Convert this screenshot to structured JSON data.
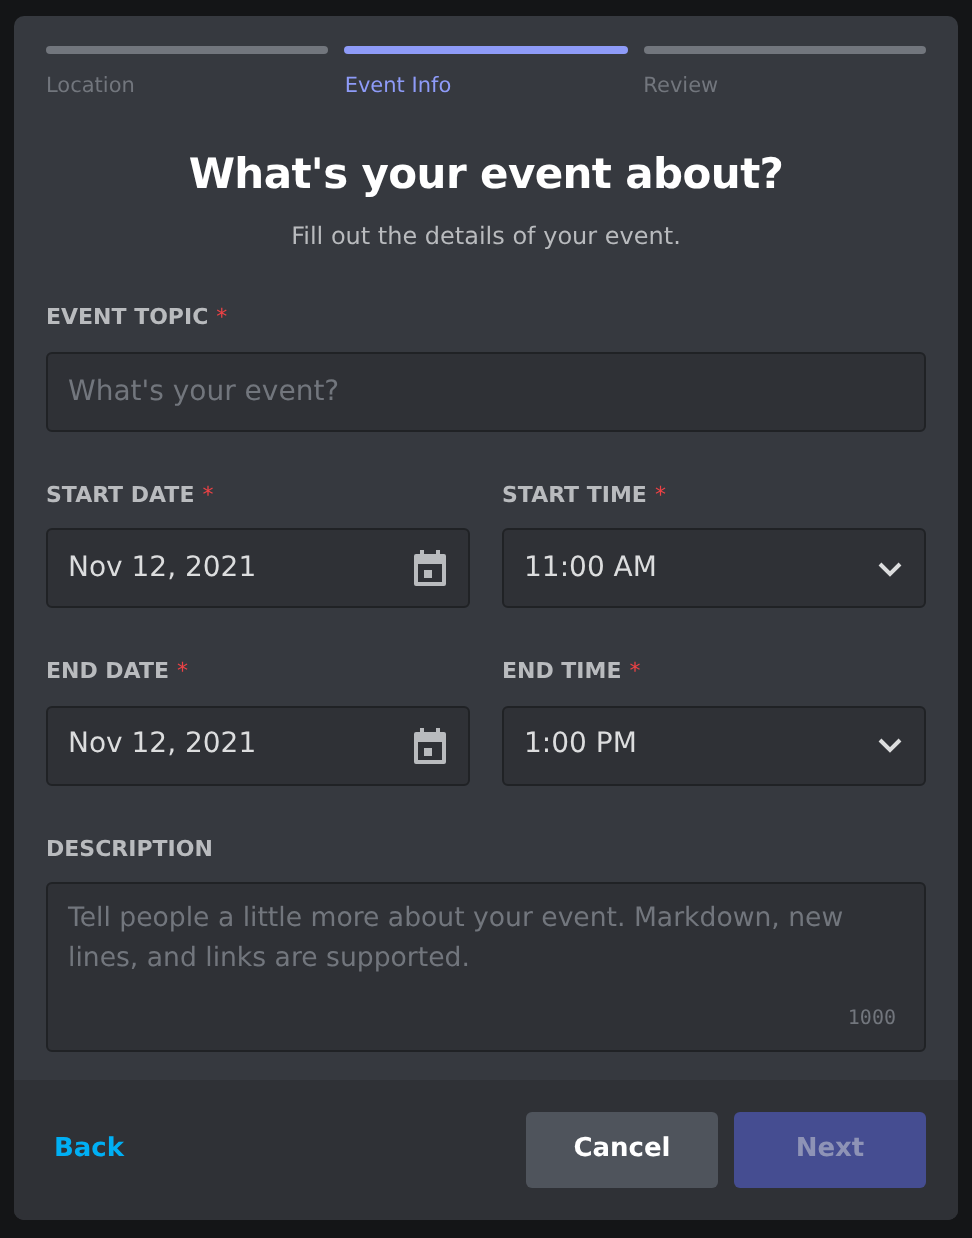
{
  "steps": [
    {
      "label": "Location",
      "selected": false
    },
    {
      "label": "Event Info",
      "selected": true
    },
    {
      "label": "Review",
      "selected": false
    }
  ],
  "title": "What's your event about?",
  "subtitle": "Fill out the details of your event.",
  "fields": [
    {
      "kind": "text",
      "label": "EVENT TOPIC",
      "required_mark": "*",
      "placeholder": "What's your event?"
    },
    {
      "kind": "date",
      "label": "START DATE",
      "required_mark": "*",
      "value": "Nov 12, 2021"
    },
    {
      "kind": "time",
      "label": "START TIME",
      "required_mark": "*",
      "value": "11:00 AM"
    },
    {
      "kind": "date",
      "label": "END DATE",
      "required_mark": "*",
      "value": "Nov 12, 2021"
    },
    {
      "kind": "time",
      "label": "END TIME",
      "required_mark": "*",
      "value": "1:00 PM"
    },
    {
      "kind": "textarea",
      "label": "DESCRIPTION",
      "placeholder": "Tell people a little more about your event. Markdown, new lines, and links are supported.",
      "counter": "1000"
    }
  ],
  "footer": {
    "back": "Back",
    "buttons": [
      {
        "label": "Cancel",
        "kind": "secondary",
        "disabled": false
      },
      {
        "label": "Next",
        "kind": "primary",
        "disabled": true
      }
    ]
  }
}
